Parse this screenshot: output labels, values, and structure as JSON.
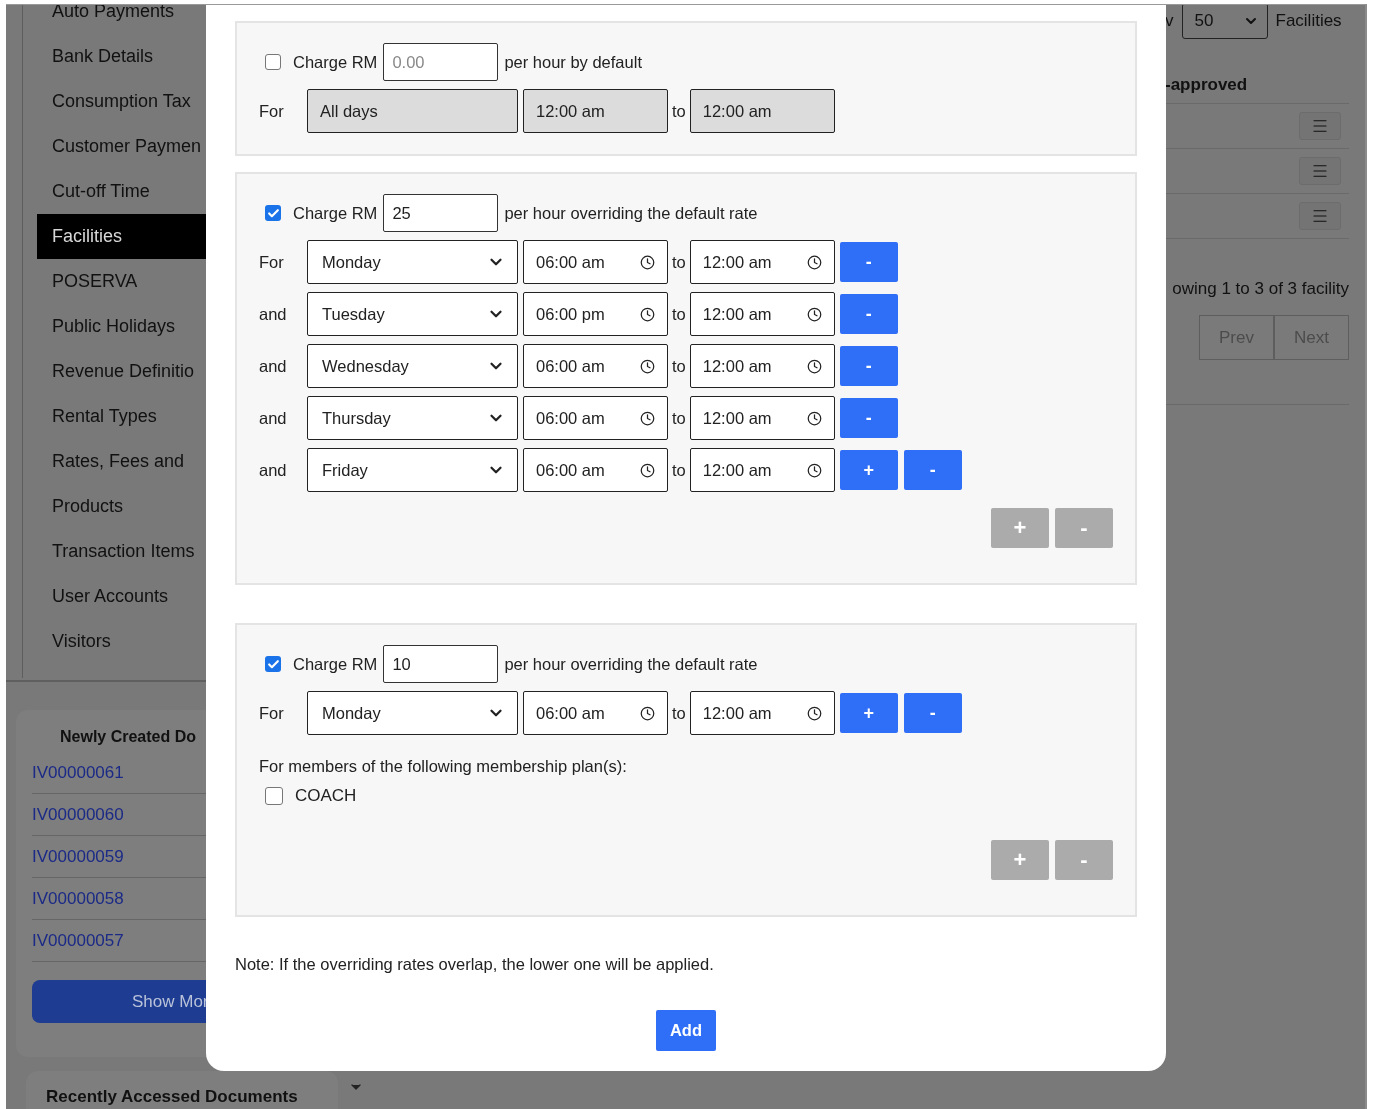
{
  "sidebar": {
    "items": [
      {
        "label": "Auto Payments",
        "selected": false
      },
      {
        "label": "Bank Details",
        "selected": false
      },
      {
        "label": "Consumption Tax",
        "selected": false
      },
      {
        "label": "Customer Paymen",
        "selected": false
      },
      {
        "label": "Cut-off Time",
        "selected": false
      },
      {
        "label": "Facilities",
        "selected": true
      },
      {
        "label": "POSERVA",
        "selected": false
      },
      {
        "label": "Public Holidays",
        "selected": false
      },
      {
        "label": "Revenue Definitio",
        "selected": false
      },
      {
        "label": "Rental Types",
        "selected": false
      },
      {
        "label": "Rates, Fees and",
        "selected": false
      },
      {
        "label": "Products",
        "selected": false
      },
      {
        "label": "Transaction Items",
        "selected": false
      },
      {
        "label": "User Accounts",
        "selected": false
      },
      {
        "label": "Visitors",
        "selected": false
      }
    ]
  },
  "newly_created": {
    "title": "Newly Created Do",
    "links": [
      "IV00000061",
      "IV00000060",
      "IV00000059",
      "IV00000058",
      "IV00000057"
    ],
    "button": "Show Mor"
  },
  "recently_accessed": {
    "title": "Recently Accessed Documents"
  },
  "list_panel": {
    "show_label": "v",
    "page_size": "50",
    "entity_label": "Facilities",
    "column_header": "-approved",
    "summary": "owing 1 to 3 of 3 facility",
    "prev": "Prev",
    "next": "Next"
  },
  "modal": {
    "rates": [
      {
        "kind": "default",
        "checked": false,
        "charge_label": "Charge RM",
        "amount": {
          "placeholder": "0.00"
        },
        "suffix": "per hour by default",
        "periods": [
          {
            "prefix": "For",
            "day": "All days",
            "from": "12:00 am",
            "to_label": "to",
            "to": "12:00 am",
            "disabled": true
          }
        ]
      },
      {
        "kind": "override",
        "checked": true,
        "charge_label": "Charge RM",
        "amount": {
          "value": "25"
        },
        "suffix": "per hour overriding the default rate",
        "periods": [
          {
            "prefix": "For",
            "day": "Monday",
            "from": "06:00 am",
            "to_label": "to",
            "to": "12:00 am",
            "disabled": false,
            "buttons": [
              "-"
            ]
          },
          {
            "prefix": "and",
            "day": "Tuesday",
            "from": "06:00 pm",
            "to_label": "to",
            "to": "12:00 am",
            "disabled": false,
            "buttons": [
              "-"
            ]
          },
          {
            "prefix": "and",
            "day": "Wednesday",
            "from": "06:00 am",
            "to_label": "to",
            "to": "12:00 am",
            "disabled": false,
            "buttons": [
              "-"
            ]
          },
          {
            "prefix": "and",
            "day": "Thursday",
            "from": "06:00 am",
            "to_label": "to",
            "to": "12:00 am",
            "disabled": false,
            "buttons": [
              "-"
            ]
          },
          {
            "prefix": "and",
            "day": "Friday",
            "from": "06:00 am",
            "to_label": "to",
            "to": "12:00 am",
            "disabled": false,
            "buttons": [
              "+",
              "-"
            ]
          }
        ],
        "footer_buttons": [
          {
            "label": "+",
            "disabled": true
          },
          {
            "label": "-",
            "disabled": true
          }
        ]
      },
      {
        "kind": "override",
        "checked": true,
        "charge_label": "Charge RM",
        "amount": {
          "value": "10"
        },
        "suffix": "per hour overriding the default rate",
        "periods": [
          {
            "prefix": "For",
            "day": "Monday",
            "from": "06:00 am",
            "to_label": "to",
            "to": "12:00 am",
            "disabled": false,
            "buttons": [
              "+",
              "-"
            ]
          }
        ],
        "membership": {
          "label": "For members of the following membership plan(s):",
          "plans": [
            {
              "label": "COACH",
              "checked": false
            }
          ]
        },
        "footer_buttons": [
          {
            "label": "+",
            "disabled": true
          },
          {
            "label": "-",
            "disabled": true
          }
        ]
      }
    ],
    "note": "Note: If the overriding rates overlap, the lower one will be applied.",
    "submit": "Add"
  }
}
